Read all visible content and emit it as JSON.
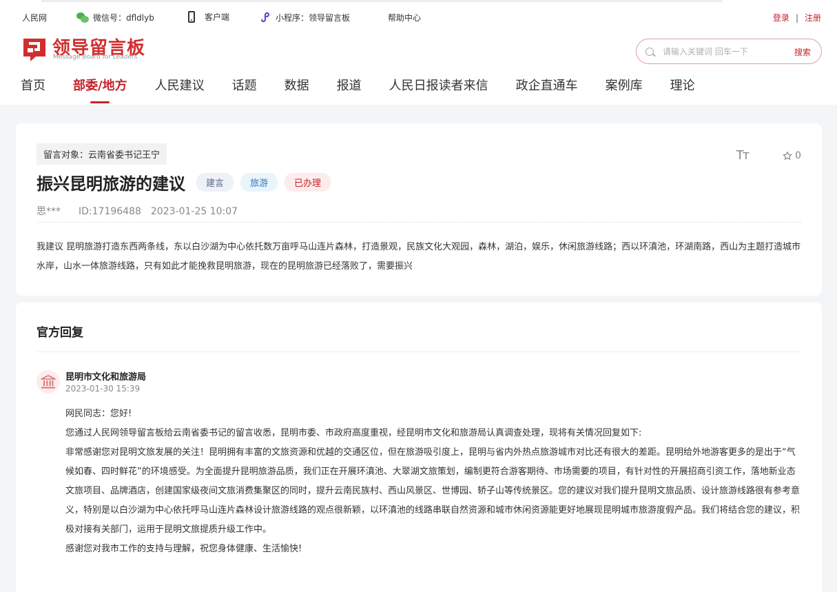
{
  "topbar": {
    "site": "人民网",
    "wechat": "微信号：dfldlyb",
    "client": "客户端",
    "miniprogram": "小程序：领导留言板",
    "help": "帮助中心",
    "login": "登录",
    "separator": "|",
    "register": "注册"
  },
  "logo": {
    "title": "领导留言板",
    "subtitle": "Message Board for Leaders",
    "color": "#d12d2e"
  },
  "search": {
    "placeholder": "请输入关键词 回车一下",
    "button": "搜索"
  },
  "nav": {
    "items": [
      "首页",
      "部委/地方",
      "人民建议",
      "话题",
      "数据",
      "报道",
      "人民日报读者来信",
      "政企直通车",
      "案例库",
      "理论"
    ],
    "active_index": 1
  },
  "message": {
    "target": "留言对象：云南省委书记王宁",
    "title": "振兴昆明旅游的建议",
    "tags": [
      "建言",
      "旅游",
      "已办理"
    ],
    "author": "思***",
    "id": "ID:17196488",
    "date": "2023-01-25 10:07",
    "font_toggle_icon": "Tт",
    "favorite_count": "0",
    "content": "我建议 昆明旅游打造东西两条线，东以白沙湖为中心依托数万亩呼马山连片森林，打造景观，民族文化大观园，森林，湖泊，娱乐，休闲旅游线路；西以环滇池，环湖南路，西山为主题打造城市水岸，山水一体旅游线路，只有如此才能挽救昆明旅游，现在的昆明旅游已经落败了，需要振兴"
  },
  "reply": {
    "heading": "官方回复",
    "org": "昆明市文化和旅游局",
    "time": "2023-01-30 15:39",
    "paragraphs": [
      "网民同志：您好!",
      "您通过人民网领导留言板给云南省委书记的留言收悉，昆明市委、市政府高度重视，经昆明市文化和旅游局认真调查处理，现将有关情况回复如下:",
      "非常感谢您对昆明文旅发展的关注！昆明拥有丰富的文旅资源和优越的交通区位，但在旅游吸引度上，昆明与省内外热点旅游城市对比还有很大的差距。昆明给外地游客更多的是出于“气候如春、四时鲜花”的环境感受。为全面提升昆明旅游品质，我们正在开展环滇池、大翠湖文旅策划，编制更符合游客期待、市场需要的项目，有针对性的开展招商引资工作，落地新业态文旅项目、品牌酒店，创建国家级夜间文旅消费集聚区的同时，提升云南民族村、西山风景区、世博园、轿子山等传统景区。您的建议对我们提升昆明文旅品质、设计旅游线路很有参考意义，特别是以白沙湖为中心依托呼马山连片森林设计旅游线路的观点很新颖，以环滇池的线路串联自然资源和城市休闲资源能更好地展现昆明城市旅游度假产品。我们将结合您的建议，积极对接有关部门，运用于昆明文旅提质升级工作中。",
      "感谢您对我市工作的支持与理解，祝您身体健康、生活愉快!"
    ]
  }
}
